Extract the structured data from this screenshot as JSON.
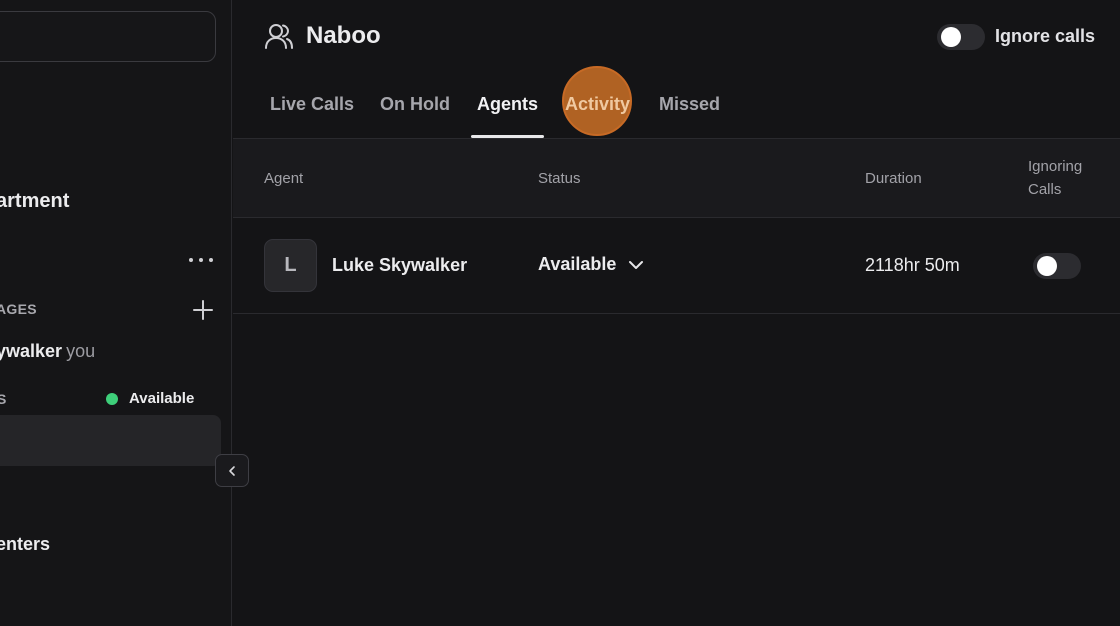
{
  "sidebar": {
    "department_title": "artment",
    "section_label": "AGES",
    "me_name": "ywalker",
    "me_suffix": "you",
    "status_label": "S",
    "status_value": "Available",
    "centers_label": "enters"
  },
  "header": {
    "title": "Naboo",
    "ignore_calls_label": "Ignore calls",
    "ignore_calls_on": false
  },
  "tabs": [
    {
      "label": "Live Calls",
      "active": false
    },
    {
      "label": "On Hold",
      "active": false
    },
    {
      "label": "Agents",
      "active": true
    },
    {
      "label": "Activity",
      "active": false
    },
    {
      "label": "Missed",
      "active": false
    }
  ],
  "table": {
    "columns": {
      "agent": "Agent",
      "status": "Status",
      "duration": "Duration",
      "ignoring_calls_line1": "Ignoring",
      "ignoring_calls_line2": "Calls"
    },
    "rows": [
      {
        "avatar_initial": "L",
        "name": "Luke Skywalker",
        "status": "Available",
        "duration": "2118hr 50m",
        "ignoring_calls": false
      }
    ]
  },
  "colors": {
    "background": "#141416",
    "available": "#3ecf7a",
    "cursor_highlight": "#dc7828"
  },
  "icons": [
    "more-icon",
    "plus-icon",
    "chevron-left-icon",
    "users-icon",
    "chevron-down-icon"
  ]
}
